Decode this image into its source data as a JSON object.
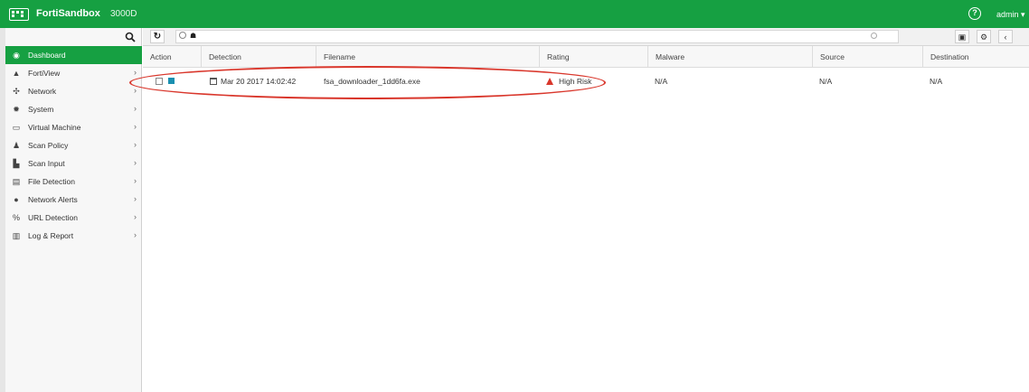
{
  "header": {
    "app_name": "FortiSandbox",
    "model": "3000D",
    "user": "admin",
    "help_glyph": "?",
    "bg_color": "#16a042",
    "logo_icon": "fortinet-logo-icon"
  },
  "sidebar": {
    "search_icon": "search-icon",
    "items": [
      {
        "label": "Dashboard",
        "icon": "dashboard-icon",
        "active": true
      },
      {
        "label": "FortiView",
        "icon": "chart-area-icon"
      },
      {
        "label": "Network",
        "icon": "network-icon"
      },
      {
        "label": "System",
        "icon": "gear-icon"
      },
      {
        "label": "Virtual Machine",
        "icon": "monitor-icon"
      },
      {
        "label": "Scan Policy",
        "icon": "user-policy-icon"
      },
      {
        "label": "Scan Input",
        "icon": "scan-input-icon"
      },
      {
        "label": "File Detection",
        "icon": "file-icon"
      },
      {
        "label": "Network Alerts",
        "icon": "globe-icon"
      },
      {
        "label": "URL Detection",
        "icon": "link-icon"
      },
      {
        "label": "Log & Report",
        "icon": "bar-chart-icon"
      }
    ]
  },
  "toolbar": {
    "refresh_icon": "refresh-icon",
    "search_value": "",
    "pdf_icon": "pdf-icon",
    "settings_icon": "gears-icon",
    "collapse_icon": "chevron-left-icon"
  },
  "table": {
    "columns": [
      "Action",
      "Detection",
      "Filename",
      "Rating",
      "Malware",
      "Source",
      "Destination"
    ],
    "rows": [
      {
        "detection": "Mar 20 2017 14:02:42",
        "filename": "fsa_downloader_1dd6fa.exe",
        "rating": "High Risk",
        "malware": "N/A",
        "source": "N/A",
        "destination": "N/A"
      }
    ]
  },
  "colors": {
    "accent": "#16a042",
    "risk": "#d9362b",
    "action_square": "#1a8fb0"
  }
}
